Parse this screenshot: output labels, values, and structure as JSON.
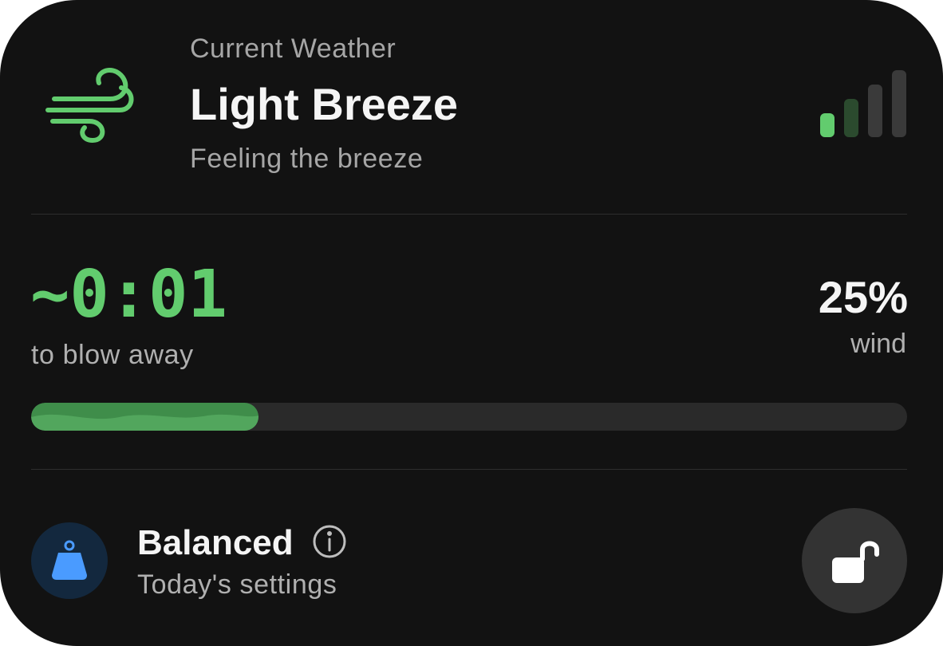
{
  "header": {
    "eyebrow": "Current Weather",
    "title": "Light Breeze",
    "subtitle": "Feeling the breeze",
    "icon": "wind-icon",
    "signal_icon": "signal-strength-icon",
    "signal_level": 1,
    "signal_max": 4
  },
  "countdown": {
    "value": "~0:01",
    "caption": "to blow away"
  },
  "wind": {
    "value": "25%",
    "label": "wind"
  },
  "progress": {
    "fraction": 0.26
  },
  "mode": {
    "title": "Balanced",
    "subtitle": "Today's settings",
    "icon": "weight-icon",
    "info_icon": "info-icon"
  },
  "lock": {
    "icon": "unlocked-padlock-icon"
  },
  "colors": {
    "background": "#121212",
    "accent_green": "#62cc6e",
    "dim_green": "#2b4a2e",
    "accent_blue": "#4a9bff"
  }
}
